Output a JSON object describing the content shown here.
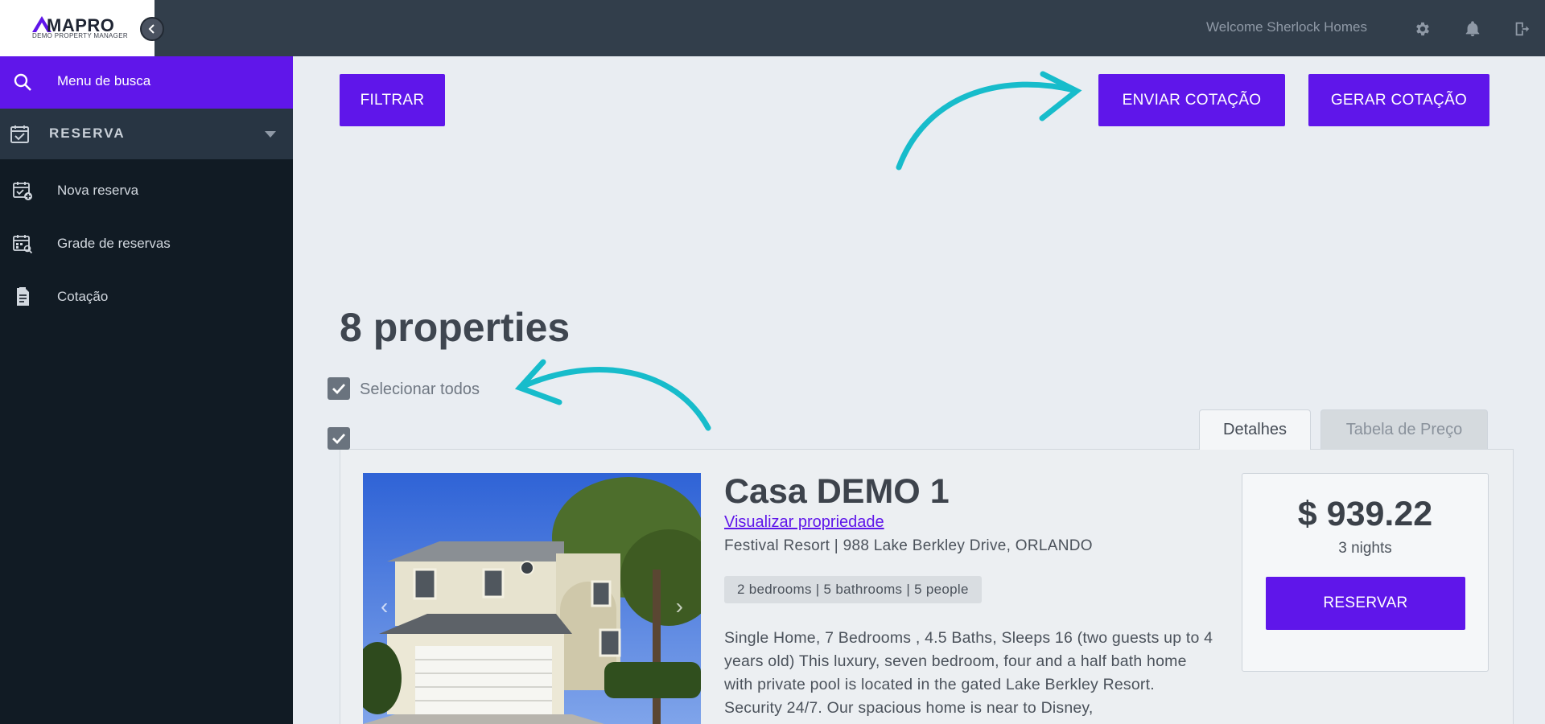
{
  "header": {
    "logo_name": "MAPRO",
    "logo_subtitle": "DEMO PROPERTY MANAGER",
    "welcome": "Welcome Sherlock Homes",
    "icons": [
      "gear-icon",
      "bell-icon",
      "logout-icon"
    ]
  },
  "sidebar": {
    "search_menu_label": "Menu de busca",
    "section_label": "RESERVA",
    "items": [
      {
        "label": "Nova reserva",
        "icon": "calendar-add-icon"
      },
      {
        "label": "Grade de reservas",
        "icon": "calendar-grid-icon"
      },
      {
        "label": "Cotação",
        "icon": "document-icon"
      }
    ]
  },
  "toolbar": {
    "filter_label": "FILTRAR",
    "send_quote_label": "ENVIAR COTAÇÃO",
    "generate_quote_label": "GERAR COTAÇÃO"
  },
  "results": {
    "count_title": "8 properties",
    "select_all_label": "Selecionar todos"
  },
  "tabs": [
    {
      "label": "Detalhes",
      "active": true
    },
    {
      "label": "Tabela de Preço",
      "active": false
    }
  ],
  "property": {
    "title": "Casa DEMO 1",
    "view_link": "Visualizar propriedade",
    "address": "Festival Resort | 988 Lake Berkley Drive, ORLANDO",
    "tag": "2 bedrooms | 5 bathrooms | 5 people",
    "description": "Single Home, 7 Bedrooms , 4.5 Baths, Sleeps 16 (two guests up to 4 years old) This luxury, seven bedroom, four and a half bath home with private pool is located in the gated Lake Berkley Resort. Security 24/7. Our spacious home is near to Disney,",
    "price": "$ 939.22",
    "nights": "3 nights",
    "reserve_label": "RESERVAR"
  },
  "colors": {
    "accent": "#5f16ea",
    "topbar": "#323e4b",
    "sidebar": "#111b24",
    "annotation_arrow": "#17bccb"
  }
}
